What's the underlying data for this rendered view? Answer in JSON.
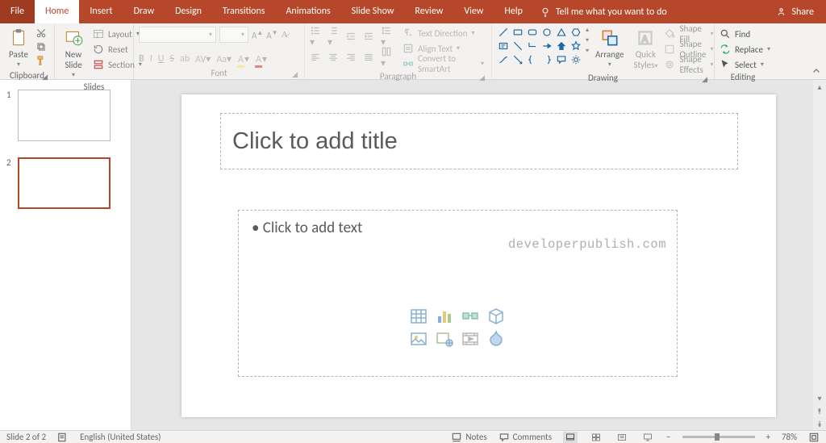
{
  "tabs": {
    "file": "File",
    "home": "Home",
    "insert": "Insert",
    "draw": "Draw",
    "design": "Design",
    "transitions": "Transitions",
    "animations": "Animations",
    "slideshow": "Slide Show",
    "review": "Review",
    "view": "View",
    "help": "Help",
    "tellme": "Tell me what you want to do",
    "share": "Share"
  },
  "ribbon": {
    "clipboard": {
      "paste": "Paste",
      "label": "Clipboard"
    },
    "slides": {
      "new_top": "New",
      "new_bot": "Slide",
      "layout": "Layout",
      "reset": "Reset",
      "section": "Section",
      "label": "Slides"
    },
    "font": {
      "placeholder_font": "",
      "placeholder_size": "",
      "label": "Font"
    },
    "paragraph": {
      "textdir": "Text Direction",
      "align": "Align Text",
      "smartart": "Convert to SmartArt",
      "label": "Paragraph"
    },
    "drawing": {
      "arrange": "Arrange",
      "quick_top": "Quick",
      "quick_bot": "Styles",
      "fill": "Shape Fill",
      "outline": "Shape Outline",
      "effects": "Shape Effects",
      "label": "Drawing"
    },
    "editing": {
      "find": "Find",
      "replace": "Replace",
      "select": "Select",
      "label": "Editing"
    }
  },
  "thumbs": {
    "n1": "1",
    "n2": "2"
  },
  "slide": {
    "title_placeholder": "Click to add title",
    "content_placeholder": "• Click to add text",
    "watermark": "developerpublish.com"
  },
  "status": {
    "slide_of": "Slide 2 of 2",
    "lang": "English (United States)",
    "notes": "Notes",
    "comments": "Comments",
    "zoom": "78%"
  }
}
